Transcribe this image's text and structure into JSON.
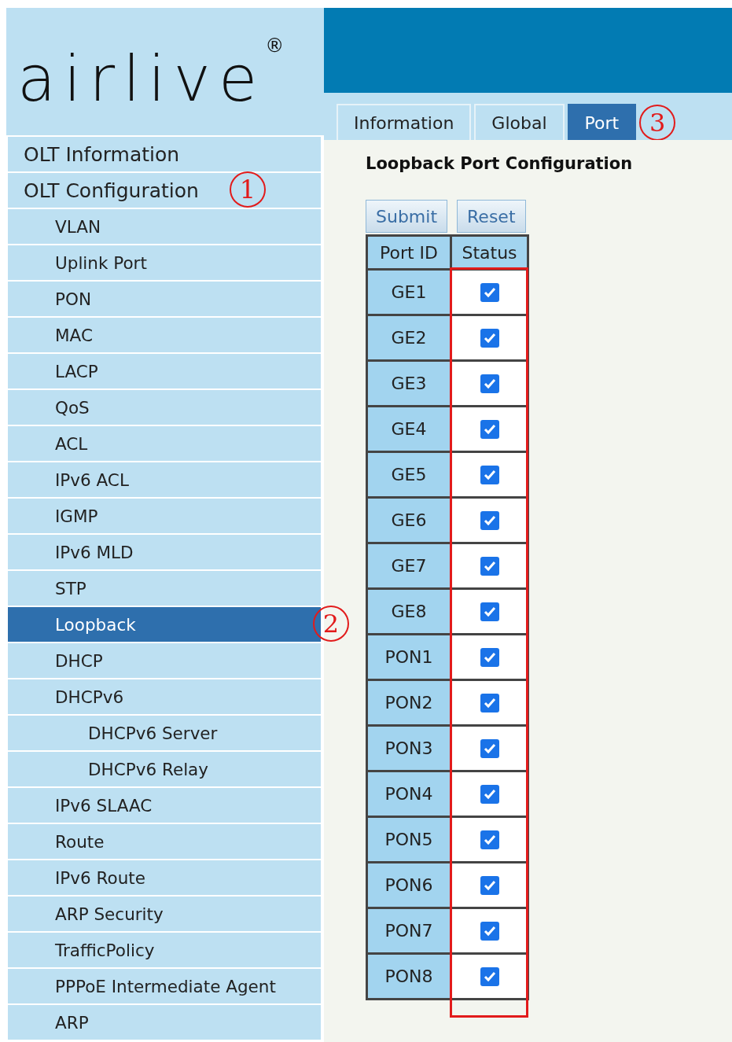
{
  "logo": {
    "text": "airlive",
    "mark": "®"
  },
  "sidebar": {
    "items": [
      {
        "label": "OLT Information",
        "selected": false
      },
      {
        "label": "OLT Configuration",
        "selected": false,
        "callout": "1",
        "children": [
          {
            "label": "VLAN",
            "selected": false
          },
          {
            "label": "Uplink Port",
            "selected": false
          },
          {
            "label": "PON",
            "selected": false
          },
          {
            "label": "MAC",
            "selected": false
          },
          {
            "label": "LACP",
            "selected": false
          },
          {
            "label": "QoS",
            "selected": false
          },
          {
            "label": "ACL",
            "selected": false
          },
          {
            "label": "IPv6 ACL",
            "selected": false
          },
          {
            "label": "IGMP",
            "selected": false
          },
          {
            "label": "IPv6 MLD",
            "selected": false
          },
          {
            "label": "STP",
            "selected": false
          },
          {
            "label": "Loopback",
            "selected": true,
            "callout": "2"
          },
          {
            "label": "DHCP",
            "selected": false
          },
          {
            "label": "DHCPv6",
            "selected": false,
            "children": [
              {
                "label": "DHCPv6 Server",
                "selected": false
              },
              {
                "label": "DHCPv6 Relay",
                "selected": false
              }
            ]
          },
          {
            "label": "IPv6 SLAAC",
            "selected": false
          },
          {
            "label": "Route",
            "selected": false
          },
          {
            "label": "IPv6 Route",
            "selected": false
          },
          {
            "label": "ARP Security",
            "selected": false
          },
          {
            "label": "TrafficPolicy",
            "selected": false
          },
          {
            "label": "PPPoE Intermediate Agent",
            "selected": false
          },
          {
            "label": "ARP",
            "selected": false
          }
        ]
      }
    ]
  },
  "tabs": [
    {
      "label": "Information",
      "selected": false
    },
    {
      "label": "Global",
      "selected": false
    },
    {
      "label": "Port",
      "selected": true
    }
  ],
  "tabs_callout": "3",
  "heading": "Loopback Port Configuration",
  "buttons": [
    "Submit",
    "Reset"
  ],
  "table": {
    "columns": [
      {
        "label": "Port ID",
        "highlighted": false
      },
      {
        "label": "Status",
        "highlighted": true
      }
    ],
    "rows": [
      {
        "port": "GE1",
        "checked": true
      },
      {
        "port": "GE2",
        "checked": true
      },
      {
        "port": "GE3",
        "checked": true
      },
      {
        "port": "GE4",
        "checked": true
      },
      {
        "port": "GE5",
        "checked": true
      },
      {
        "port": "GE6",
        "checked": true
      },
      {
        "port": "GE7",
        "checked": true
      },
      {
        "port": "GE8",
        "checked": true
      },
      {
        "port": "PON1",
        "checked": true
      },
      {
        "port": "PON2",
        "checked": true
      },
      {
        "port": "PON3",
        "checked": true
      },
      {
        "port": "PON4",
        "checked": true
      },
      {
        "port": "PON5",
        "checked": true
      },
      {
        "port": "PON6",
        "checked": true
      },
      {
        "port": "PON7",
        "checked": true
      },
      {
        "port": "PON8",
        "checked": true
      }
    ]
  }
}
